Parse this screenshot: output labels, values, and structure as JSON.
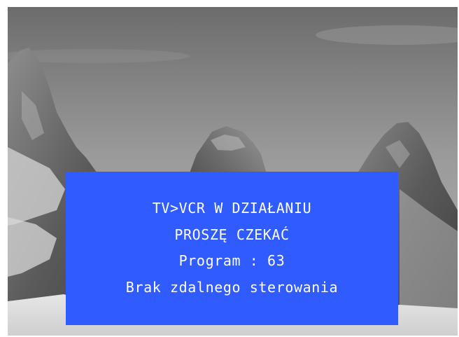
{
  "osd": {
    "background_color": "#2f5bff",
    "text_color": "#ffffff",
    "line1": "TV>VCR W DZIAŁANIU",
    "line2": "PROSZĘ CZEKAĆ",
    "line3": "Program : 63",
    "line4": "Brak zdalnego sterowania"
  },
  "background": {
    "description_icon": "mountain-landscape-image"
  }
}
